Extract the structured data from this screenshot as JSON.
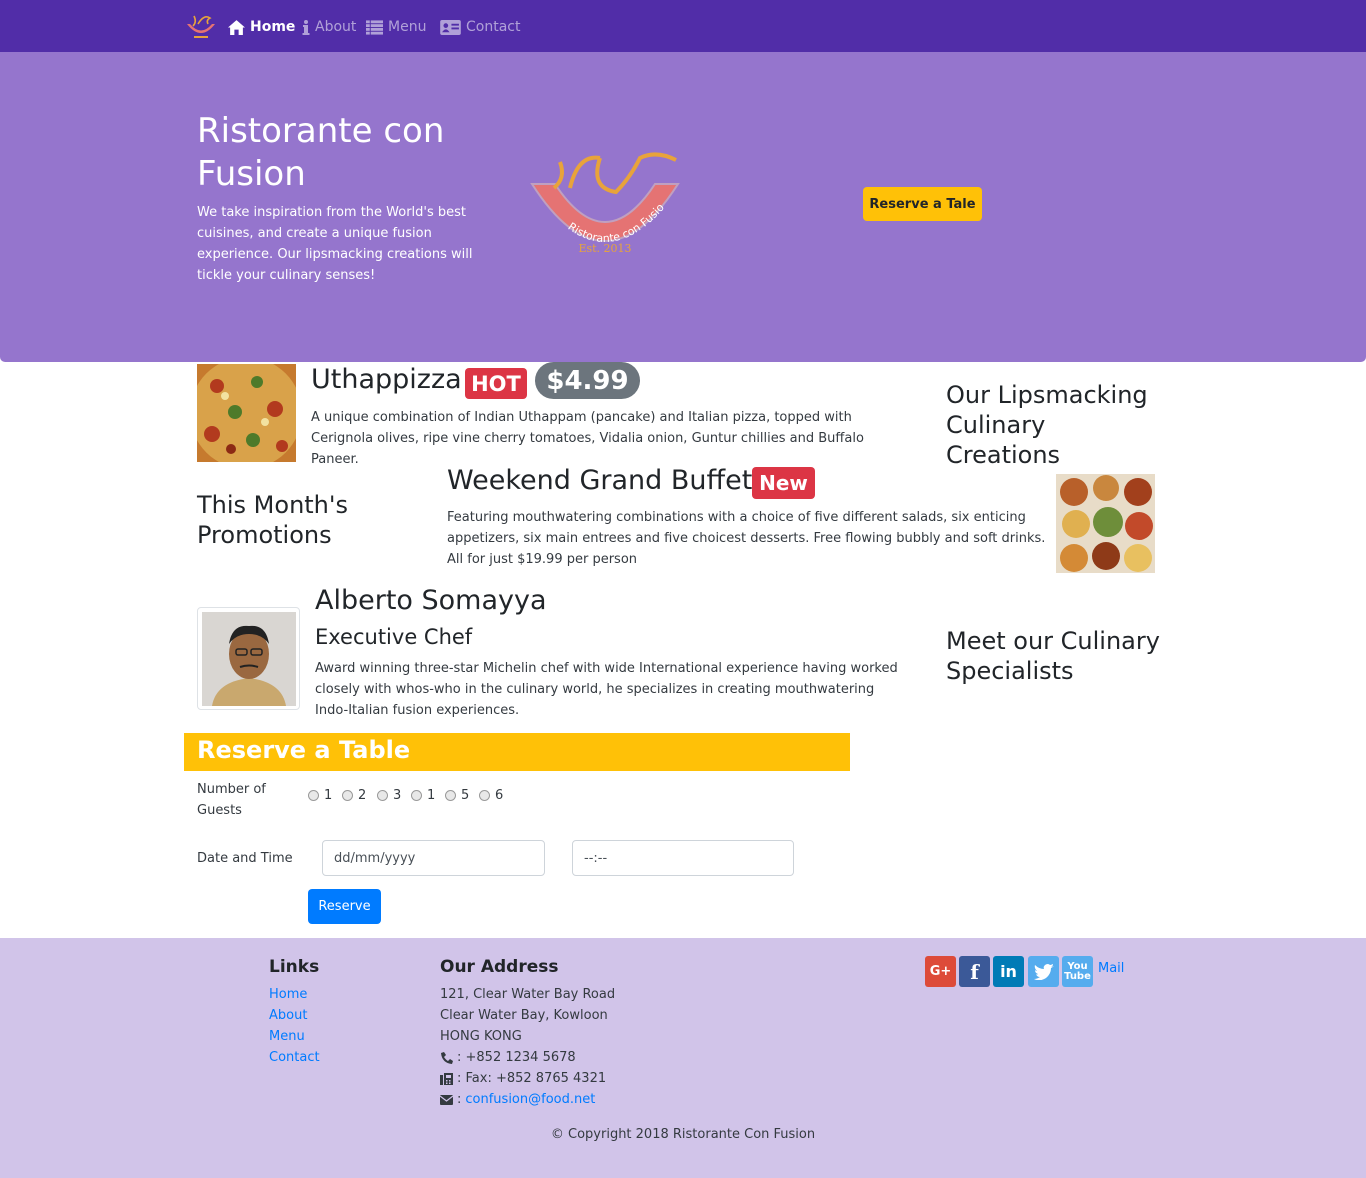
{
  "nav": {
    "items": [
      {
        "label": "Home",
        "icon": "home-icon"
      },
      {
        "label": "About",
        "icon": "info-icon"
      },
      {
        "label": "Menu",
        "icon": "list-icon"
      },
      {
        "label": "Contact",
        "icon": "address-card-icon"
      }
    ]
  },
  "jumbotron": {
    "title": "Ristorante con Fusion",
    "text": "We take inspiration from the World's best cuisines, and create a unique fusion experience. Our lipsmacking creations will tickle your culinary senses!",
    "logo_text": "Ristorante con Fusion",
    "logo_est": "Est. 2013",
    "cta_label": "Reserve a Tale"
  },
  "dish": {
    "name": "Uthappizza",
    "badge": "HOT",
    "price": "$4.99",
    "description": "A unique combination of Indian Uthappam (pancake) and Italian pizza, topped with Cerignola olives, ripe vine cherry tomatoes, Vidalia onion, Guntur chillies and Buffalo Paneer.",
    "side_heading": "Our Lipsmacking Culinary Creations"
  },
  "promotion": {
    "side_heading": "This Month's Promotions",
    "name": "Weekend Grand Buffet",
    "badge": "New",
    "description": "Featuring mouthwatering combinations with a choice of five different salads, six enticing appetizers, six main entrees and five choicest desserts. Free flowing bubbly and soft drinks. All for just $19.99 per person"
  },
  "chef": {
    "name": "Alberto Somayya",
    "role": "Executive Chef",
    "description": "Award winning three-star Michelin chef with wide International experience having worked closely with whos-who in the culinary world, he specializes in creating mouthwatering Indo-Italian fusion experiences.",
    "side_heading": "Meet our Culinary Specialists"
  },
  "reserve": {
    "title": "Reserve a Table",
    "guests_label": "Number of Guests",
    "guest_options": [
      "1",
      "2",
      "3",
      "1",
      "5",
      "6"
    ],
    "datetime_label": "Date and Time",
    "date_placeholder": "dd/mm/yyyy",
    "time_placeholder": "--:--",
    "submit_label": "Reserve"
  },
  "footer": {
    "links_heading": "Links",
    "links": [
      "Home",
      "About",
      "Menu",
      "Contact"
    ],
    "address_heading": "Our Address",
    "address_lines": [
      "121, Clear Water Bay Road",
      "Clear Water Bay, Kowloon",
      "HONG KONG"
    ],
    "phone": ": +852 1234 5678",
    "fax": ": Fax: +852 8765 4321",
    "email_prefix": ":",
    "email": "confusion@food.net",
    "mail_label": "Mail",
    "social": [
      {
        "icon": "google-plus-icon",
        "color": "#DD4B39"
      },
      {
        "icon": "facebook-icon",
        "color": "#3B5998"
      },
      {
        "icon": "linkedin-icon",
        "color": "#007BB6"
      },
      {
        "icon": "twitter-icon",
        "color": "#55ACEE"
      },
      {
        "icon": "youtube-icon",
        "color": "#55ACEE"
      }
    ],
    "copyright": "© Copyright 2018 Ristorante Con Fusion"
  },
  "colors": {
    "navbar": "#512DA8",
    "jumbotron": "#9575CD",
    "accent": "#FFC107",
    "footer": "#D1C4E9",
    "primary": "#007BFF",
    "danger": "#DC3545"
  }
}
